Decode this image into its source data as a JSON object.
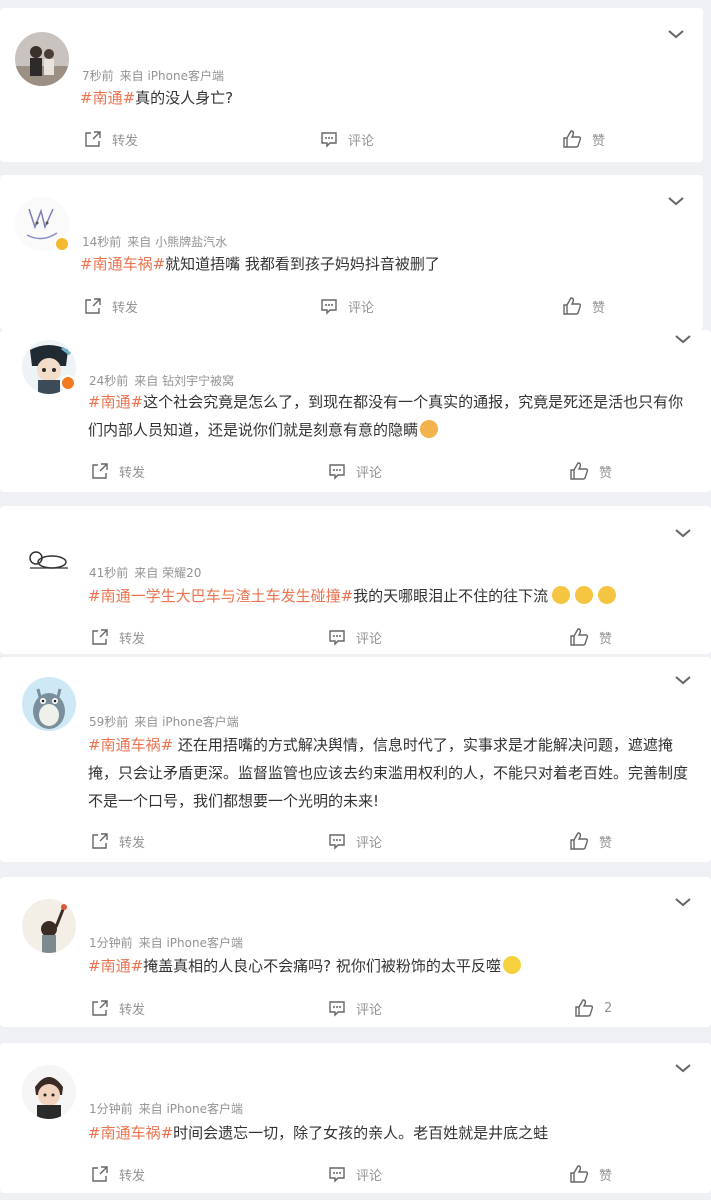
{
  "posts": [
    {
      "time": "7秒前",
      "source": "来自 iPhone客户端",
      "hashtag": "#南通#",
      "text": "真的没人身亡?",
      "actions": {
        "repost": "转发",
        "comment": "评论",
        "like": "赞"
      }
    },
    {
      "time": "14秒前",
      "source": "来自 小熊牌盐汽水",
      "hashtag": "#南通车祸#",
      "text": "就知道捂嘴 我都看到孩子妈妈抖音被删了",
      "actions": {
        "repost": "转发",
        "comment": "评论",
        "like": "赞"
      }
    },
    {
      "time": "24秒前",
      "source": "来自 钻刘宇宁被窝",
      "hashtag": "#南通#",
      "text": "这个社会究竟是怎么了，到现在都没有一个真实的通报，究竟是死还是活也只有你们内部人员知道，还是说你们就是刻意有意的隐瞒",
      "actions": {
        "repost": "转发",
        "comment": "评论",
        "like": "赞"
      }
    },
    {
      "time": "41秒前",
      "source": "来自 荣耀20",
      "hashtag": "#南通一学生大巴车与渣土车发生碰撞#",
      "text": "我的天哪眼泪止不住的往下流",
      "actions": {
        "repost": "转发",
        "comment": "评论",
        "like": "赞"
      }
    },
    {
      "time": "59秒前",
      "source": "来自 iPhone客户端",
      "hashtag": "#南通车祸#",
      "text": " 还在用捂嘴的方式解决舆情，信息时代了，实事求是才能解决问题，遮遮掩掩，只会让矛盾更深。监督监管也应该去约束滥用权利的人，不能只对着老百姓。完善制度不是一个口号，我们都想要一个光明的未来!",
      "actions": {
        "repost": "转发",
        "comment": "评论",
        "like": "赞"
      }
    },
    {
      "time": "1分钟前",
      "source": "来自 iPhone客户端",
      "hashtag": "#南通#",
      "text": "掩盖真相的人良心不会痛吗? 祝你们被粉饰的太平反噬",
      "actions": {
        "repost": "转发",
        "comment": "评论",
        "like": "2"
      }
    },
    {
      "time": "1分钟前",
      "source": "来自 iPhone客户端",
      "hashtag": "#南通车祸#",
      "text": "时间会遗忘一切，除了女孩的亲人。老百姓就是井底之蛙",
      "actions": {
        "repost": "转发",
        "comment": "评论",
        "like": "赞"
      }
    }
  ],
  "colors": {
    "hashtag": "#eb7350",
    "meta": "#939393",
    "background": "#eff0f3"
  },
  "icons": [
    "repost-icon",
    "comment-icon",
    "like-icon",
    "chevron-down-icon"
  ]
}
